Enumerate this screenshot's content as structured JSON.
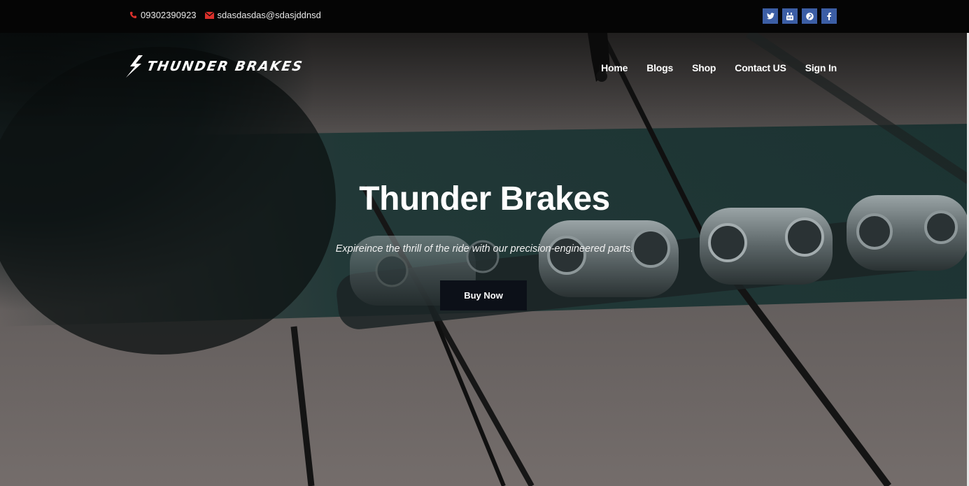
{
  "topbar": {
    "phone": "09302390923",
    "email": "sdasdasdas@sdasjddnsd",
    "social": [
      {
        "name": "twitter",
        "icon": "twitter-icon"
      },
      {
        "name": "youtube",
        "icon": "youtube-icon"
      },
      {
        "name": "pinterest",
        "icon": "pinterest-icon"
      },
      {
        "name": "facebook",
        "icon": "facebook-icon"
      }
    ]
  },
  "brand": {
    "logo_text": "THUNDER BRAKES"
  },
  "nav": {
    "home": "Home",
    "blogs": "Blogs",
    "shop": "Shop",
    "contact": "Contact US",
    "signin": "Sign In"
  },
  "hero": {
    "title": "Thunder Brakes",
    "subtitle": "Expireince the thrill of the ride with our precision-engineered parts.",
    "cta": "Buy Now"
  },
  "colors": {
    "social_bg": "#3c5ea5",
    "contact_icon": "#d9302b",
    "button_bg": "#0c1018"
  }
}
